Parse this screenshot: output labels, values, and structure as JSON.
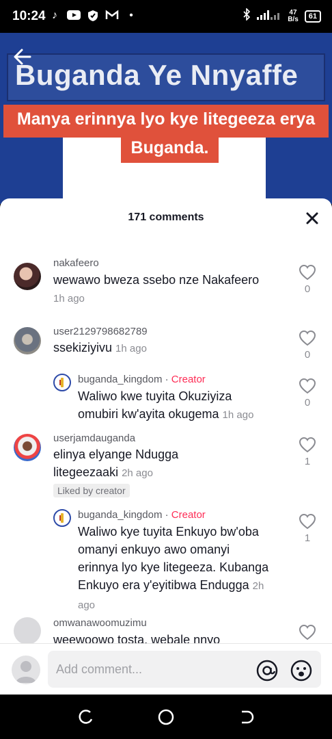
{
  "status_bar": {
    "time": "10:24",
    "speed_value": "47",
    "speed_unit": "B/s",
    "battery": "61",
    "icons": [
      "tiktok-icon",
      "youtube-icon",
      "shield-icon",
      "gmail-icon",
      "dot-icon",
      "bluetooth-icon",
      "signal-icon"
    ]
  },
  "video": {
    "title": "Buganda Ye Nnyaffe",
    "subtitle_line1": "Manya erinnya lyo kye litegeeza erya",
    "subtitle_line2": "Buganda.",
    "colors": {
      "blue": "#1e3f93",
      "banner": "#2d4d9c",
      "red": "#e0513b"
    }
  },
  "comments_sheet": {
    "count_label": "171 comments",
    "comments": [
      {
        "username": "nakafeero",
        "text": "wewawo bweza ssebo nze Nakafeero",
        "time": "1h ago",
        "likes": "0"
      },
      {
        "username": "user2129798682789",
        "text": "ssekiziyivu",
        "time": "1h ago",
        "likes": "0"
      },
      {
        "username": "buganda_kingdom",
        "creator_label": "Creator",
        "separator": " · ",
        "text_line1": "Waliwo kwe tuyita Okuziyiza",
        "text_line2": "omubiri kw'ayita okugema",
        "time": "1h ago",
        "likes": "0"
      },
      {
        "username": "userjamdauganda",
        "text_line1": "elinya elyange Ndugga",
        "text_line2": "litegeezaaki",
        "time": "2h ago",
        "likes": "1",
        "badge": "Liked by creator"
      },
      {
        "username": "buganda_kingdom",
        "creator_label": "Creator",
        "separator": " · ",
        "text_line1": "Waliwo kye tuyita Enkuyo bw'oba",
        "text_line2": "omanyi enkuyo awo omanyi",
        "text_line3": "erinnya lyo kye litegeeza. Kubanga",
        "text_line4": "Enkuyo era y'eyitibwa Endugga",
        "time": "2h",
        "time_line2": "ago",
        "likes": "1"
      },
      {
        "username": "omwanawoomuzimu",
        "text": "weewoowo tosta, webale nnyo",
        "time": "",
        "likes": ""
      }
    ]
  },
  "composer": {
    "placeholder": "Add comment..."
  },
  "accent": "#fe2c55"
}
